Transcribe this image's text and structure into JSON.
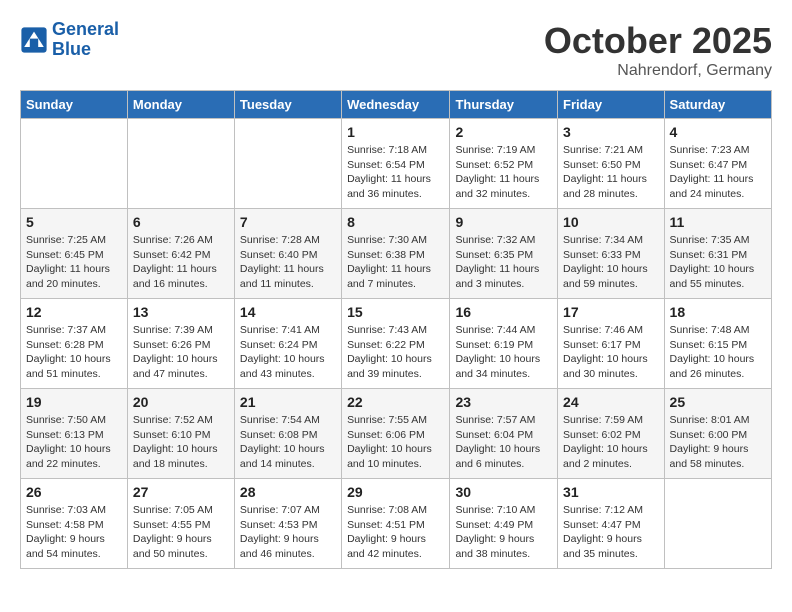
{
  "header": {
    "logo_line1": "General",
    "logo_line2": "Blue",
    "month": "October 2025",
    "location": "Nahrendorf, Germany"
  },
  "days_of_week": [
    "Sunday",
    "Monday",
    "Tuesday",
    "Wednesday",
    "Thursday",
    "Friday",
    "Saturday"
  ],
  "weeks": [
    [
      {
        "day": "",
        "sunrise": "",
        "sunset": "",
        "daylight": ""
      },
      {
        "day": "",
        "sunrise": "",
        "sunset": "",
        "daylight": ""
      },
      {
        "day": "",
        "sunrise": "",
        "sunset": "",
        "daylight": ""
      },
      {
        "day": "1",
        "sunrise": "Sunrise: 7:18 AM",
        "sunset": "Sunset: 6:54 PM",
        "daylight": "Daylight: 11 hours and 36 minutes."
      },
      {
        "day": "2",
        "sunrise": "Sunrise: 7:19 AM",
        "sunset": "Sunset: 6:52 PM",
        "daylight": "Daylight: 11 hours and 32 minutes."
      },
      {
        "day": "3",
        "sunrise": "Sunrise: 7:21 AM",
        "sunset": "Sunset: 6:50 PM",
        "daylight": "Daylight: 11 hours and 28 minutes."
      },
      {
        "day": "4",
        "sunrise": "Sunrise: 7:23 AM",
        "sunset": "Sunset: 6:47 PM",
        "daylight": "Daylight: 11 hours and 24 minutes."
      }
    ],
    [
      {
        "day": "5",
        "sunrise": "Sunrise: 7:25 AM",
        "sunset": "Sunset: 6:45 PM",
        "daylight": "Daylight: 11 hours and 20 minutes."
      },
      {
        "day": "6",
        "sunrise": "Sunrise: 7:26 AM",
        "sunset": "Sunset: 6:42 PM",
        "daylight": "Daylight: 11 hours and 16 minutes."
      },
      {
        "day": "7",
        "sunrise": "Sunrise: 7:28 AM",
        "sunset": "Sunset: 6:40 PM",
        "daylight": "Daylight: 11 hours and 11 minutes."
      },
      {
        "day": "8",
        "sunrise": "Sunrise: 7:30 AM",
        "sunset": "Sunset: 6:38 PM",
        "daylight": "Daylight: 11 hours and 7 minutes."
      },
      {
        "day": "9",
        "sunrise": "Sunrise: 7:32 AM",
        "sunset": "Sunset: 6:35 PM",
        "daylight": "Daylight: 11 hours and 3 minutes."
      },
      {
        "day": "10",
        "sunrise": "Sunrise: 7:34 AM",
        "sunset": "Sunset: 6:33 PM",
        "daylight": "Daylight: 10 hours and 59 minutes."
      },
      {
        "day": "11",
        "sunrise": "Sunrise: 7:35 AM",
        "sunset": "Sunset: 6:31 PM",
        "daylight": "Daylight: 10 hours and 55 minutes."
      }
    ],
    [
      {
        "day": "12",
        "sunrise": "Sunrise: 7:37 AM",
        "sunset": "Sunset: 6:28 PM",
        "daylight": "Daylight: 10 hours and 51 minutes."
      },
      {
        "day": "13",
        "sunrise": "Sunrise: 7:39 AM",
        "sunset": "Sunset: 6:26 PM",
        "daylight": "Daylight: 10 hours and 47 minutes."
      },
      {
        "day": "14",
        "sunrise": "Sunrise: 7:41 AM",
        "sunset": "Sunset: 6:24 PM",
        "daylight": "Daylight: 10 hours and 43 minutes."
      },
      {
        "day": "15",
        "sunrise": "Sunrise: 7:43 AM",
        "sunset": "Sunset: 6:22 PM",
        "daylight": "Daylight: 10 hours and 39 minutes."
      },
      {
        "day": "16",
        "sunrise": "Sunrise: 7:44 AM",
        "sunset": "Sunset: 6:19 PM",
        "daylight": "Daylight: 10 hours and 34 minutes."
      },
      {
        "day": "17",
        "sunrise": "Sunrise: 7:46 AM",
        "sunset": "Sunset: 6:17 PM",
        "daylight": "Daylight: 10 hours and 30 minutes."
      },
      {
        "day": "18",
        "sunrise": "Sunrise: 7:48 AM",
        "sunset": "Sunset: 6:15 PM",
        "daylight": "Daylight: 10 hours and 26 minutes."
      }
    ],
    [
      {
        "day": "19",
        "sunrise": "Sunrise: 7:50 AM",
        "sunset": "Sunset: 6:13 PM",
        "daylight": "Daylight: 10 hours and 22 minutes."
      },
      {
        "day": "20",
        "sunrise": "Sunrise: 7:52 AM",
        "sunset": "Sunset: 6:10 PM",
        "daylight": "Daylight: 10 hours and 18 minutes."
      },
      {
        "day": "21",
        "sunrise": "Sunrise: 7:54 AM",
        "sunset": "Sunset: 6:08 PM",
        "daylight": "Daylight: 10 hours and 14 minutes."
      },
      {
        "day": "22",
        "sunrise": "Sunrise: 7:55 AM",
        "sunset": "Sunset: 6:06 PM",
        "daylight": "Daylight: 10 hours and 10 minutes."
      },
      {
        "day": "23",
        "sunrise": "Sunrise: 7:57 AM",
        "sunset": "Sunset: 6:04 PM",
        "daylight": "Daylight: 10 hours and 6 minutes."
      },
      {
        "day": "24",
        "sunrise": "Sunrise: 7:59 AM",
        "sunset": "Sunset: 6:02 PM",
        "daylight": "Daylight: 10 hours and 2 minutes."
      },
      {
        "day": "25",
        "sunrise": "Sunrise: 8:01 AM",
        "sunset": "Sunset: 6:00 PM",
        "daylight": "Daylight: 9 hours and 58 minutes."
      }
    ],
    [
      {
        "day": "26",
        "sunrise": "Sunrise: 7:03 AM",
        "sunset": "Sunset: 4:58 PM",
        "daylight": "Daylight: 9 hours and 54 minutes."
      },
      {
        "day": "27",
        "sunrise": "Sunrise: 7:05 AM",
        "sunset": "Sunset: 4:55 PM",
        "daylight": "Daylight: 9 hours and 50 minutes."
      },
      {
        "day": "28",
        "sunrise": "Sunrise: 7:07 AM",
        "sunset": "Sunset: 4:53 PM",
        "daylight": "Daylight: 9 hours and 46 minutes."
      },
      {
        "day": "29",
        "sunrise": "Sunrise: 7:08 AM",
        "sunset": "Sunset: 4:51 PM",
        "daylight": "Daylight: 9 hours and 42 minutes."
      },
      {
        "day": "30",
        "sunrise": "Sunrise: 7:10 AM",
        "sunset": "Sunset: 4:49 PM",
        "daylight": "Daylight: 9 hours and 38 minutes."
      },
      {
        "day": "31",
        "sunrise": "Sunrise: 7:12 AM",
        "sunset": "Sunset: 4:47 PM",
        "daylight": "Daylight: 9 hours and 35 minutes."
      },
      {
        "day": "",
        "sunrise": "",
        "sunset": "",
        "daylight": ""
      }
    ]
  ]
}
